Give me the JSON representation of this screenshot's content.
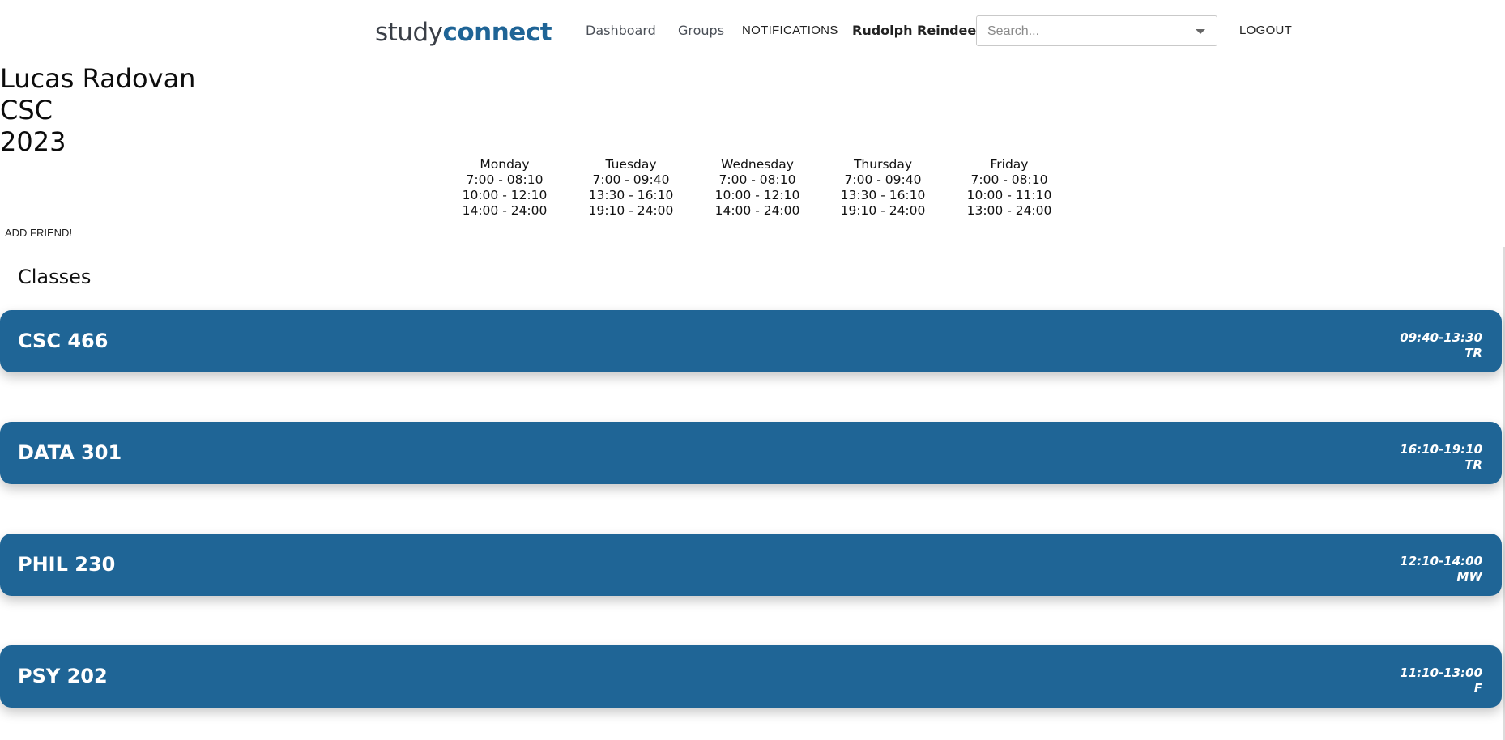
{
  "nav": {
    "logo_part1": "study",
    "logo_part2": "connect",
    "links": [
      "Dashboard",
      "Groups",
      "NOTIFICATIONS"
    ],
    "user": "Rudolph Reindeer",
    "search_placeholder": "Search...",
    "logout": "LOGOUT"
  },
  "profile": {
    "name": "Lucas Radovan",
    "major": "CSC",
    "year": "2023",
    "add_friend": "ADD FRIEND!"
  },
  "availability": [
    {
      "day": "Monday",
      "slots": [
        "7:00 - 08:10",
        "10:00 - 12:10",
        "14:00 - 24:00"
      ]
    },
    {
      "day": "Tuesday",
      "slots": [
        "7:00 - 09:40",
        "13:30 - 16:10",
        "19:10 - 24:00"
      ]
    },
    {
      "day": "Wednesday",
      "slots": [
        "7:00 - 08:10",
        "10:00 - 12:10",
        "14:00 - 24:00"
      ]
    },
    {
      "day": "Thursday",
      "slots": [
        "7:00 - 09:40",
        "13:30 - 16:10",
        "19:10 - 24:00"
      ]
    },
    {
      "day": "Friday",
      "slots": [
        "7:00 - 08:10",
        "10:00 - 11:10",
        "13:00 - 24:00"
      ]
    }
  ],
  "classes": {
    "title": "Classes",
    "items": [
      {
        "name": "CSC 466",
        "time": "09:40-13:30",
        "days": "TR"
      },
      {
        "name": "DATA 301",
        "time": "16:10-19:10",
        "days": "TR"
      },
      {
        "name": "PHIL 230",
        "time": "12:10-14:00",
        "days": "MW"
      },
      {
        "name": "PSY 202",
        "time": "11:10-13:00",
        "days": "F"
      }
    ]
  },
  "colors": {
    "accent": "#1f6596",
    "logo_dark": "#3a3f47"
  }
}
